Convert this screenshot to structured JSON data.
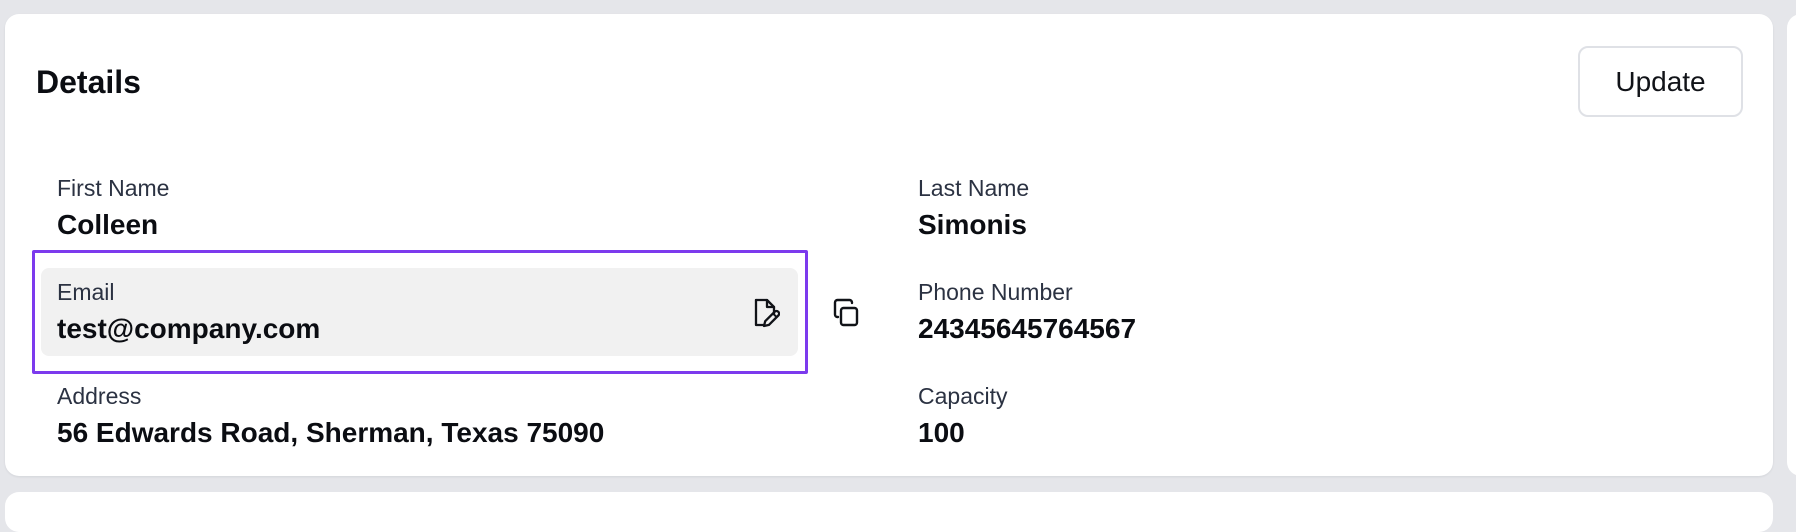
{
  "details_card": {
    "title": "Details",
    "update_button_label": "Update"
  },
  "fields": {
    "first_name": {
      "label": "First Name",
      "value": "Colleen"
    },
    "last_name": {
      "label": "Last Name",
      "value": "Simonis"
    },
    "email": {
      "label": "Email",
      "value": "test@company.com"
    },
    "phone_number": {
      "label": "Phone Number",
      "value": "24345645764567"
    },
    "address": {
      "label": "Address",
      "value": "56 Edwards Road, Sherman, Texas 75090"
    },
    "capacity": {
      "label": "Capacity",
      "value": "100"
    }
  },
  "icons": {
    "edit_email": "file-edit-icon",
    "copy_email": "copy-icon"
  },
  "colors": {
    "page_background": "#e5e6ea",
    "card_background": "#ffffff",
    "email_background": "#f1f1f1",
    "focus_ring": "#7c3aed",
    "primary_text": "#0b0d12",
    "secondary_text": "#2b3242"
  }
}
